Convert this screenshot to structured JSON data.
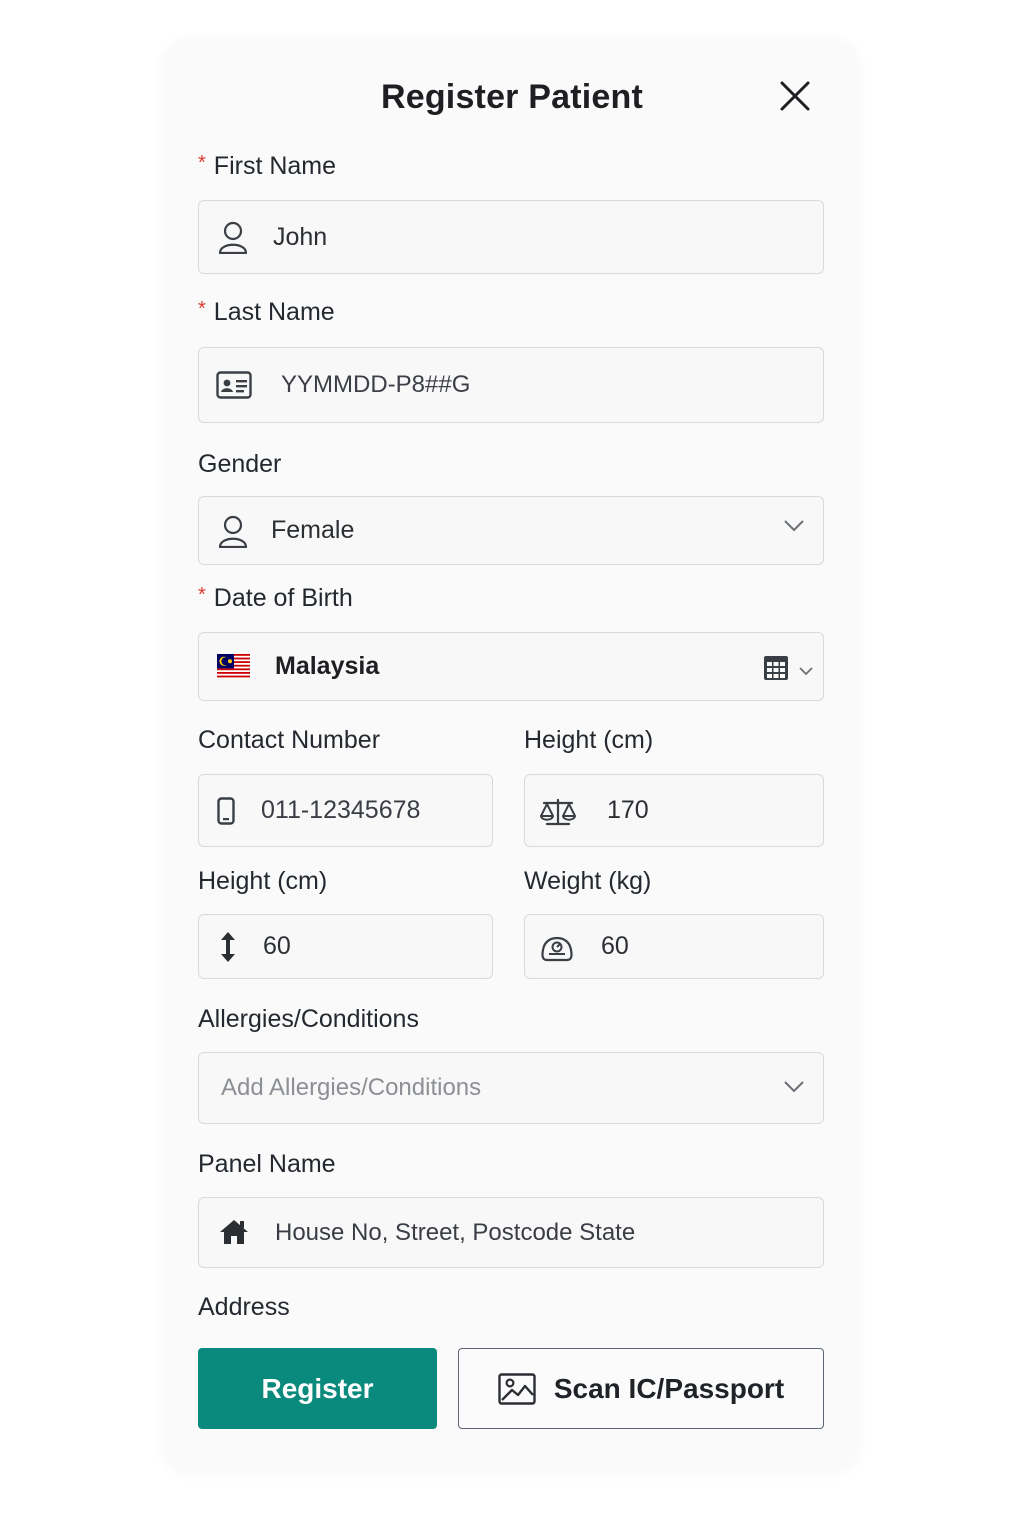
{
  "dialog": {
    "title": "Register Patient"
  },
  "fields": {
    "first_name": {
      "label": "First Name",
      "required_mark": "*",
      "value": "John",
      "icon": "user-icon"
    },
    "last_name": {
      "label": "Last Name",
      "required_mark": "*",
      "value": "YYMMDD-P8##G",
      "icon": "id-card-icon"
    },
    "gender": {
      "label": "Gender",
      "value": "Female",
      "icon": "user-icon"
    },
    "dob": {
      "label": "Date of Birth",
      "required_mark": "*",
      "value": "Malaysia",
      "icon": "malaysia-flag-icon",
      "trailing_icon": "calendar-icon"
    },
    "contact": {
      "label": "Contact Number",
      "value": "011-12345678",
      "icon": "phone-icon"
    },
    "height_top": {
      "label": "Height (cm)",
      "value": "170",
      "icon": "scale-icon"
    },
    "height_bottom": {
      "label": "Height (cm)",
      "value": "60",
      "icon": "height-arrow-icon"
    },
    "weight": {
      "label": "Weight (kg)",
      "value": "60",
      "icon": "weight-icon"
    },
    "allergies": {
      "label": "Allergies/Conditions",
      "placeholder": "Add Allergies/Conditions"
    },
    "panel": {
      "label": "Panel Name",
      "placeholder": "House No, Street, Postcode State",
      "icon": "home-icon"
    },
    "address": {
      "label": "Address"
    }
  },
  "buttons": {
    "register": "Register",
    "scan": "Scan IC/Passport"
  },
  "colors": {
    "accent": "#0a8a7c",
    "required": "#d93a2b",
    "border": "#d9d9d9"
  }
}
